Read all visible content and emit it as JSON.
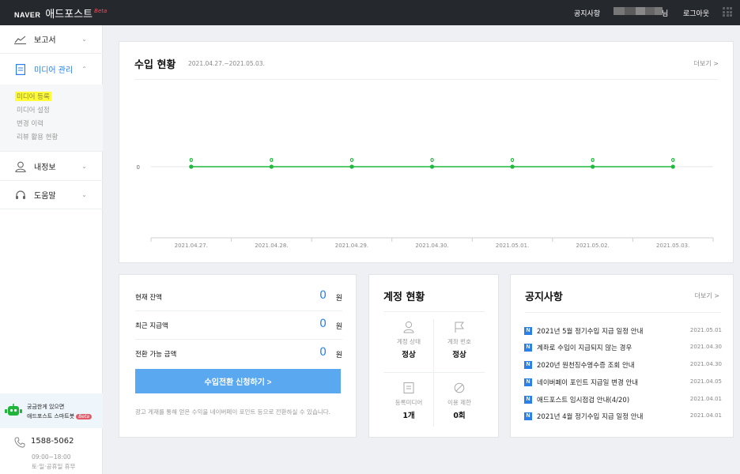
{
  "topbar": {
    "brand_naver": "NAVER",
    "brand_name": "애드포스트",
    "brand_beta": "Beta",
    "notice_link": "공지사항",
    "user_suffix": "님",
    "logout": "로그아웃",
    "apps_icon": "grid-icon"
  },
  "sidebar": {
    "menu": {
      "report": {
        "label": "보고서",
        "icon": "chart-icon"
      },
      "media": {
        "label": "미디어 관리",
        "icon": "document-icon"
      },
      "myinfo": {
        "label": "내정보",
        "icon": "user-icon"
      },
      "help": {
        "label": "도움말",
        "icon": "headset-icon"
      }
    },
    "sub_items": [
      "미디어 등록",
      "미디어 설정",
      "변경 이력",
      "리뷰 활용 현황"
    ],
    "chatbot": {
      "line1": "궁금한게 있으면",
      "line2": "애드포스트 스마트봇",
      "badge": "Beta"
    },
    "support": {
      "phone": "1588-5062",
      "hours": "09:00~18:00",
      "holidays": "토·일·공휴일 휴무"
    }
  },
  "revenue": {
    "title": "수입 현황",
    "date_range": "2021.04.27.~2021.05.03.",
    "more": "더보기 >"
  },
  "chart_data": {
    "type": "line",
    "x": [
      "2021.04.27.",
      "2021.04.28.",
      "2021.04.29.",
      "2021.04.30.",
      "2021.05.01.",
      "2021.05.02.",
      "2021.05.03."
    ],
    "series": [
      {
        "values": [
          0,
          0,
          0,
          0,
          0,
          0,
          0
        ]
      }
    ],
    "data_labels": [
      "0",
      "0",
      "0",
      "0",
      "0",
      "0",
      "0"
    ],
    "y_ticks": [
      "0"
    ],
    "color": "#1fba3d",
    "grid": false
  },
  "balance": {
    "rows": [
      {
        "label": "현재 잔액",
        "value": "0",
        "unit": "원"
      },
      {
        "label": "최근 지급액",
        "value": "0",
        "unit": "원"
      },
      {
        "label": "전환 가능 금액",
        "value": "0",
        "unit": "원"
      }
    ],
    "button": "수입전환 신청하기 >",
    "note": "광고 게재를 통해 얻은 수익을 네이버페이 포인트 등으로 전환하실 수 있습니다."
  },
  "account": {
    "title": "계정 현황",
    "cells": [
      {
        "label": "계정 상태",
        "value": "정상",
        "icon": "person-icon"
      },
      {
        "label": "계좌 번호",
        "value": "정상",
        "icon": "flag-icon"
      },
      {
        "label": "등록미디어",
        "value": "1개",
        "icon": "media-icon"
      },
      {
        "label": "이용 제한",
        "value": "0회",
        "icon": "prohibited-icon"
      }
    ]
  },
  "notices": {
    "title": "공지사항",
    "more": "더보기 >",
    "badge": "N",
    "items": [
      {
        "title": "2021년 5월 정기수입 지급 일정 안내",
        "date": "2021.05.01"
      },
      {
        "title": "계좌로 수입이 지급되지 않는 경우",
        "date": "2021.04.30"
      },
      {
        "title": "2020년 원천징수영수증 조회 안내",
        "date": "2021.04.30"
      },
      {
        "title": "네이버페이 포인트 지급일 변경 안내",
        "date": "2021.04.05"
      },
      {
        "title": "애드포스트 임시점검 안내(4/20)",
        "date": "2021.04.01"
      },
      {
        "title": "2021년 4월 정기수입 지급 일정 안내",
        "date": "2021.04.01"
      }
    ]
  },
  "colors": {
    "accent": "#2a7fe8",
    "button": "#5aa8ef",
    "line": "#1fba3d",
    "highlight": "#fffb3a",
    "topbar": "#25282d"
  }
}
